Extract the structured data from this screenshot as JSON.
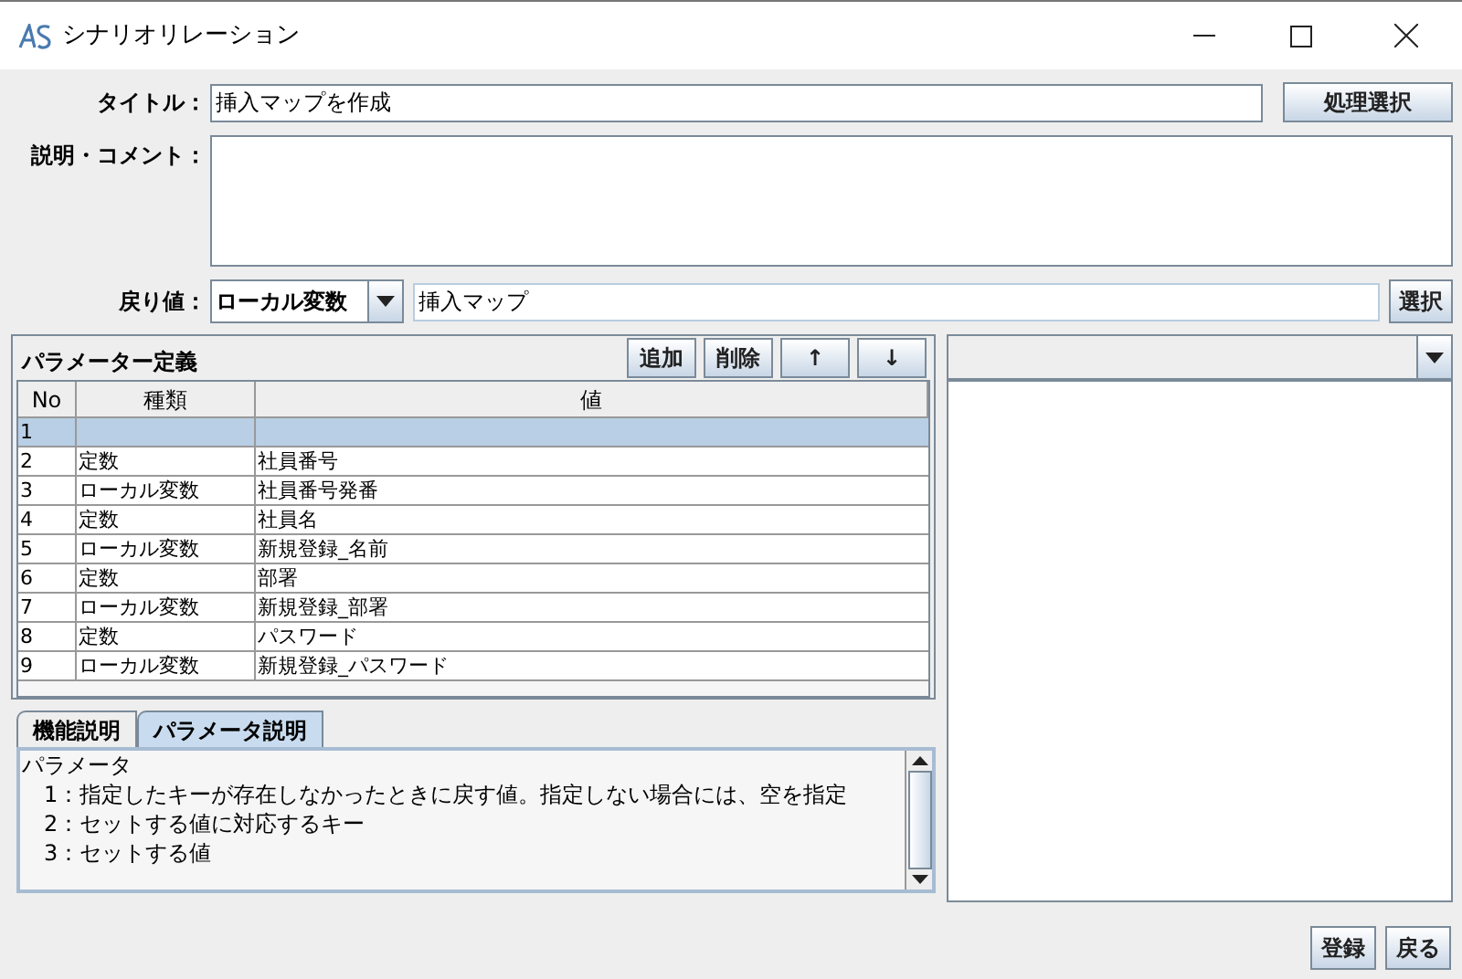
{
  "window": {
    "title": "シナリオリレーション"
  },
  "form": {
    "title_label": "タイトル：",
    "title_value": "挿入マップを作成",
    "process_button": "処理選択",
    "description_label": "説明・コメント：",
    "return_label": "戻り値：",
    "return_kind": "ローカル変数",
    "return_value": "挿入マップ",
    "select_button": "選択"
  },
  "parameters": {
    "title": "パラメーター定義",
    "buttons": [
      "追加",
      "削除",
      "↑",
      "↓"
    ],
    "columns": [
      "No",
      "種類",
      "値"
    ],
    "rows": [
      {
        "no": "1",
        "kind": "",
        "value": "",
        "selected": true
      },
      {
        "no": "2",
        "kind": "定数",
        "value": "社員番号",
        "selected": false
      },
      {
        "no": "3",
        "kind": "ローカル変数",
        "value": "社員番号発番",
        "selected": false
      },
      {
        "no": "4",
        "kind": "定数",
        "value": "社員名",
        "selected": false
      },
      {
        "no": "5",
        "kind": "ローカル変数",
        "value": "新規登録_名前",
        "selected": false
      },
      {
        "no": "6",
        "kind": "定数",
        "value": "部署",
        "selected": false
      },
      {
        "no": "7",
        "kind": "ローカル変数",
        "value": "新規登録_部署",
        "selected": false
      },
      {
        "no": "8",
        "kind": "定数",
        "value": "パスワード",
        "selected": false
      },
      {
        "no": "9",
        "kind": "ローカル変数",
        "value": "新規登録_パスワード",
        "selected": false
      }
    ]
  },
  "help_tabs": [
    {
      "label": "機能説明",
      "selected": false
    },
    {
      "label": "パラメータ説明",
      "selected": true
    }
  ],
  "help_text": [
    "パラメータ",
    "　1：指定したキーが存在しなかったときに戻す値。指定しない場合には、空を指定",
    "　2：セットする値に対応するキー",
    "　3：セットする値"
  ],
  "footer_buttons": [
    "登録",
    "戻る"
  ]
}
